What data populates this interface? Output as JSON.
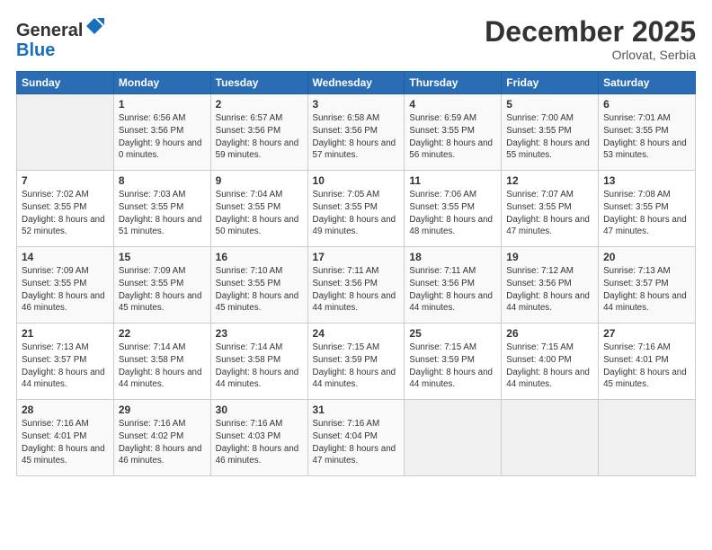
{
  "logo": {
    "general": "General",
    "blue": "Blue"
  },
  "header": {
    "month": "December 2025",
    "location": "Orlovat, Serbia"
  },
  "weekdays": [
    "Sunday",
    "Monday",
    "Tuesday",
    "Wednesday",
    "Thursday",
    "Friday",
    "Saturday"
  ],
  "weeks": [
    [
      {
        "day": "",
        "sunrise": "",
        "sunset": "",
        "daylight": "",
        "empty": true
      },
      {
        "day": "1",
        "sunrise": "Sunrise: 6:56 AM",
        "sunset": "Sunset: 3:56 PM",
        "daylight": "Daylight: 9 hours and 0 minutes."
      },
      {
        "day": "2",
        "sunrise": "Sunrise: 6:57 AM",
        "sunset": "Sunset: 3:56 PM",
        "daylight": "Daylight: 8 hours and 59 minutes."
      },
      {
        "day": "3",
        "sunrise": "Sunrise: 6:58 AM",
        "sunset": "Sunset: 3:56 PM",
        "daylight": "Daylight: 8 hours and 57 minutes."
      },
      {
        "day": "4",
        "sunrise": "Sunrise: 6:59 AM",
        "sunset": "Sunset: 3:55 PM",
        "daylight": "Daylight: 8 hours and 56 minutes."
      },
      {
        "day": "5",
        "sunrise": "Sunrise: 7:00 AM",
        "sunset": "Sunset: 3:55 PM",
        "daylight": "Daylight: 8 hours and 55 minutes."
      },
      {
        "day": "6",
        "sunrise": "Sunrise: 7:01 AM",
        "sunset": "Sunset: 3:55 PM",
        "daylight": "Daylight: 8 hours and 53 minutes."
      }
    ],
    [
      {
        "day": "7",
        "sunrise": "Sunrise: 7:02 AM",
        "sunset": "Sunset: 3:55 PM",
        "daylight": "Daylight: 8 hours and 52 minutes."
      },
      {
        "day": "8",
        "sunrise": "Sunrise: 7:03 AM",
        "sunset": "Sunset: 3:55 PM",
        "daylight": "Daylight: 8 hours and 51 minutes."
      },
      {
        "day": "9",
        "sunrise": "Sunrise: 7:04 AM",
        "sunset": "Sunset: 3:55 PM",
        "daylight": "Daylight: 8 hours and 50 minutes."
      },
      {
        "day": "10",
        "sunrise": "Sunrise: 7:05 AM",
        "sunset": "Sunset: 3:55 PM",
        "daylight": "Daylight: 8 hours and 49 minutes."
      },
      {
        "day": "11",
        "sunrise": "Sunrise: 7:06 AM",
        "sunset": "Sunset: 3:55 PM",
        "daylight": "Daylight: 8 hours and 48 minutes."
      },
      {
        "day": "12",
        "sunrise": "Sunrise: 7:07 AM",
        "sunset": "Sunset: 3:55 PM",
        "daylight": "Daylight: 8 hours and 47 minutes."
      },
      {
        "day": "13",
        "sunrise": "Sunrise: 7:08 AM",
        "sunset": "Sunset: 3:55 PM",
        "daylight": "Daylight: 8 hours and 47 minutes."
      }
    ],
    [
      {
        "day": "14",
        "sunrise": "Sunrise: 7:09 AM",
        "sunset": "Sunset: 3:55 PM",
        "daylight": "Daylight: 8 hours and 46 minutes."
      },
      {
        "day": "15",
        "sunrise": "Sunrise: 7:09 AM",
        "sunset": "Sunset: 3:55 PM",
        "daylight": "Daylight: 8 hours and 45 minutes."
      },
      {
        "day": "16",
        "sunrise": "Sunrise: 7:10 AM",
        "sunset": "Sunset: 3:55 PM",
        "daylight": "Daylight: 8 hours and 45 minutes."
      },
      {
        "day": "17",
        "sunrise": "Sunrise: 7:11 AM",
        "sunset": "Sunset: 3:56 PM",
        "daylight": "Daylight: 8 hours and 44 minutes."
      },
      {
        "day": "18",
        "sunrise": "Sunrise: 7:11 AM",
        "sunset": "Sunset: 3:56 PM",
        "daylight": "Daylight: 8 hours and 44 minutes."
      },
      {
        "day": "19",
        "sunrise": "Sunrise: 7:12 AM",
        "sunset": "Sunset: 3:56 PM",
        "daylight": "Daylight: 8 hours and 44 minutes."
      },
      {
        "day": "20",
        "sunrise": "Sunrise: 7:13 AM",
        "sunset": "Sunset: 3:57 PM",
        "daylight": "Daylight: 8 hours and 44 minutes."
      }
    ],
    [
      {
        "day": "21",
        "sunrise": "Sunrise: 7:13 AM",
        "sunset": "Sunset: 3:57 PM",
        "daylight": "Daylight: 8 hours and 44 minutes."
      },
      {
        "day": "22",
        "sunrise": "Sunrise: 7:14 AM",
        "sunset": "Sunset: 3:58 PM",
        "daylight": "Daylight: 8 hours and 44 minutes."
      },
      {
        "day": "23",
        "sunrise": "Sunrise: 7:14 AM",
        "sunset": "Sunset: 3:58 PM",
        "daylight": "Daylight: 8 hours and 44 minutes."
      },
      {
        "day": "24",
        "sunrise": "Sunrise: 7:15 AM",
        "sunset": "Sunset: 3:59 PM",
        "daylight": "Daylight: 8 hours and 44 minutes."
      },
      {
        "day": "25",
        "sunrise": "Sunrise: 7:15 AM",
        "sunset": "Sunset: 3:59 PM",
        "daylight": "Daylight: 8 hours and 44 minutes."
      },
      {
        "day": "26",
        "sunrise": "Sunrise: 7:15 AM",
        "sunset": "Sunset: 4:00 PM",
        "daylight": "Daylight: 8 hours and 44 minutes."
      },
      {
        "day": "27",
        "sunrise": "Sunrise: 7:16 AM",
        "sunset": "Sunset: 4:01 PM",
        "daylight": "Daylight: 8 hours and 45 minutes."
      }
    ],
    [
      {
        "day": "28",
        "sunrise": "Sunrise: 7:16 AM",
        "sunset": "Sunset: 4:01 PM",
        "daylight": "Daylight: 8 hours and 45 minutes."
      },
      {
        "day": "29",
        "sunrise": "Sunrise: 7:16 AM",
        "sunset": "Sunset: 4:02 PM",
        "daylight": "Daylight: 8 hours and 46 minutes."
      },
      {
        "day": "30",
        "sunrise": "Sunrise: 7:16 AM",
        "sunset": "Sunset: 4:03 PM",
        "daylight": "Daylight: 8 hours and 46 minutes."
      },
      {
        "day": "31",
        "sunrise": "Sunrise: 7:16 AM",
        "sunset": "Sunset: 4:04 PM",
        "daylight": "Daylight: 8 hours and 47 minutes."
      },
      {
        "day": "",
        "sunrise": "",
        "sunset": "",
        "daylight": "",
        "empty": true
      },
      {
        "day": "",
        "sunrise": "",
        "sunset": "",
        "daylight": "",
        "empty": true
      },
      {
        "day": "",
        "sunrise": "",
        "sunset": "",
        "daylight": "",
        "empty": true
      }
    ]
  ]
}
